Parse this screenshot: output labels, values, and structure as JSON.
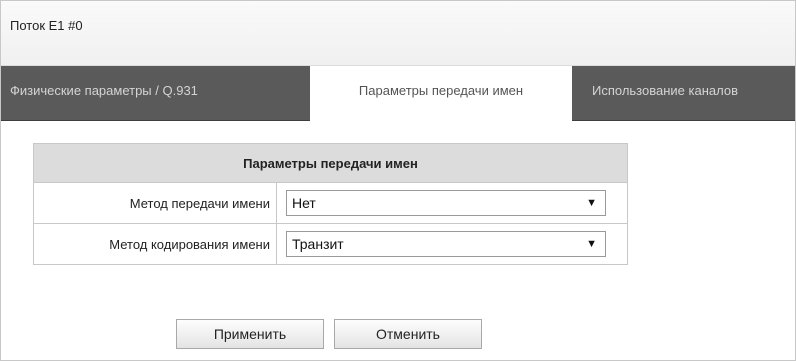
{
  "window": {
    "title": "Поток E1 #0"
  },
  "tabs": [
    {
      "label": "Физические параметры / Q.931",
      "active": false
    },
    {
      "label": "Параметры передачи имен",
      "active": true
    },
    {
      "label": "Использование каналов",
      "active": false
    }
  ],
  "params_table": {
    "header": "Параметры передачи имен",
    "rows": [
      {
        "label": "Метод передачи имени",
        "value": "Нет"
      },
      {
        "label": "Метод кодирования имени",
        "value": "Транзит"
      }
    ]
  },
  "buttons": {
    "apply_label": "Применить",
    "cancel_label": "Отменить"
  },
  "colors": {
    "tabbar_bg": "#5a5a5a",
    "header_bg": "#dcdcdc",
    "border": "#c8c8c8"
  },
  "icons": {
    "dropdown": "chevron-down-icon"
  }
}
